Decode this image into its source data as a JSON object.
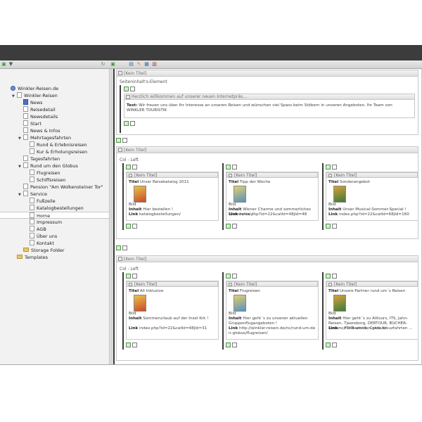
{
  "tree": {
    "items": [
      {
        "label": "Winkler-Reisen.de",
        "level": 0,
        "icon": "globe-icon"
      },
      {
        "label": "Winkler-Reisen",
        "level": 1,
        "icon": "page-icon",
        "expand": "open"
      },
      {
        "label": "News",
        "level": 2,
        "icon": "news-icon"
      },
      {
        "label": "Reisedetail",
        "level": 2,
        "icon": "page-icon"
      },
      {
        "label": "Newsdetails",
        "level": 2,
        "icon": "page-icon"
      },
      {
        "label": "Start",
        "level": 2,
        "icon": "page-icon"
      },
      {
        "label": "News & Infos",
        "level": 2,
        "icon": "page-icon"
      },
      {
        "label": "Mehrtagesfahrten",
        "level": 2,
        "icon": "page-icon",
        "expand": "open"
      },
      {
        "label": "Rund & Erlebnisreisen",
        "level": 3,
        "icon": "page-icon"
      },
      {
        "label": "Kur & Erholungsreisen",
        "level": 3,
        "icon": "page-icon"
      },
      {
        "label": "Tagesfahrten",
        "level": 2,
        "icon": "page-icon"
      },
      {
        "label": "Rund um den Globus",
        "level": 2,
        "icon": "page-icon",
        "expand": "open"
      },
      {
        "label": "Flugreisen",
        "level": 3,
        "icon": "page-icon"
      },
      {
        "label": "Schiffsreisen",
        "level": 3,
        "icon": "page-icon"
      },
      {
        "label": "Pension \"Am Wolkensteiner Tor\"",
        "level": 2,
        "icon": "page-icon"
      },
      {
        "label": "Service",
        "level": 2,
        "icon": "page-icon",
        "expand": "open"
      },
      {
        "label": "Fußzeile",
        "level": 3,
        "icon": "page-icon"
      },
      {
        "label": "Katalogbestellungen",
        "level": 3,
        "icon": "page-icon"
      },
      {
        "label": "Home",
        "level": 3,
        "icon": "page-icon",
        "selected": true
      },
      {
        "label": "Impressum",
        "level": 3,
        "icon": "page-icon"
      },
      {
        "label": "AGB",
        "level": 3,
        "icon": "page-icon"
      },
      {
        "label": "Über uns",
        "level": 3,
        "icon": "page-icon"
      },
      {
        "label": "Kontakt",
        "level": 3,
        "icon": "page-icon"
      },
      {
        "label": "Storage Folder",
        "level": 2,
        "icon": "folder-icon"
      },
      {
        "label": "Templates",
        "level": 1,
        "icon": "folder-icon"
      }
    ]
  },
  "content": {
    "no_title": "[Kein Titel]",
    "section1": {
      "label": "Seiteninhalt's-Element",
      "welcome_title": "Herzlich willkommen auf unserer neuen Internetpräs...",
      "text_label": "Text:",
      "text_body": "Wir freuen uns über Ihr Interesse an unseren Reisen und wünschen viel Spass beim Stöbern in unseren Angeboten. Ihr Team von WINKLER TOURISTIK"
    },
    "col_left_label": "Col - Left",
    "row1": [
      {
        "titel": "Unser Reisekatalog 2011",
        "inhalt": "Hier bestellen !",
        "link": "katalogbestellungen/"
      },
      {
        "titel": "Tipp der Woche",
        "inhalt": "Wiener Charme und sommerliches Weinviertel !",
        "link": "index.php?id=22&catId=48jId=48"
      },
      {
        "titel": "Sonderangebot",
        "inhalt": "Unser Musical-Sommer-Special !",
        "link": "index.php?id=22&catId=68jId=160"
      }
    ],
    "row2": [
      {
        "titel": "All Inklusive",
        "inhalt": "Sommerurlaub auf der Insel Krk !",
        "link": "index.php?id=22&catId=48jId=31"
      },
      {
        "titel": "Flugreisen",
        "inhalt": "Hier geht´s zu unseren aktuellen Gruppenflugangeboten !",
        "link": "http://winkler-reisen.de/nc/rund-um-den-globus/flugreisen/"
      },
      {
        "titel": "Unsere Partner rund um´s Reisen",
        "inhalt": "Hier geht´s zu Alltours, ITS, Jahn-Reisen, Tjaereborg, DERTOUR, BUCHER-Reisen, FTI-Touristik, Costa Kreuzfahrten ...",
        "link": "nc/rund-um-den-globus/"
      }
    ],
    "labels": {
      "titel": "Titel",
      "bild": "Bild",
      "inhalt": "Inhalt",
      "link": "Link"
    }
  },
  "colors": {
    "topbar": "#3c3c3c",
    "tree_bg": "#f2f2f2",
    "accent_green": "#3c9c3c"
  }
}
